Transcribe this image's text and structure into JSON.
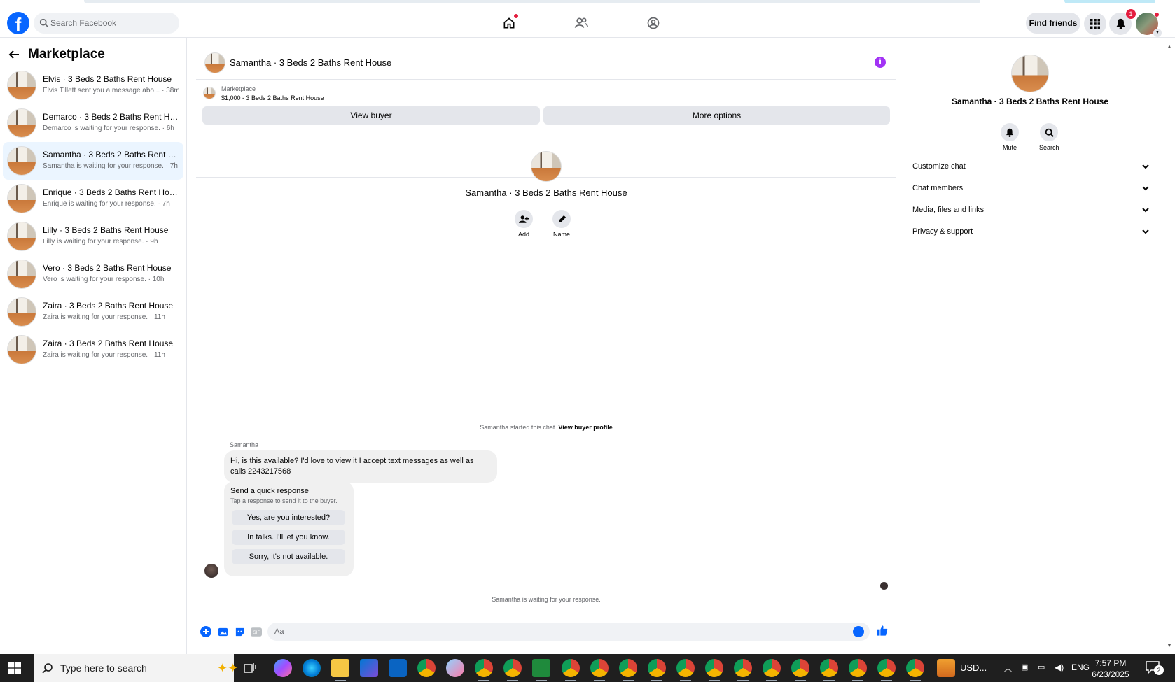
{
  "header": {
    "search_placeholder": "Search Facebook",
    "find_friends": "Find friends",
    "notification_count": "1"
  },
  "sidebar": {
    "title": "Marketplace",
    "conversations": [
      {
        "name": "Elvis · 3 Beds 2 Baths Rent House",
        "preview": "Elvis Tillett sent you a message abo... · 38m",
        "active": false
      },
      {
        "name": "Demarco · 3 Beds 2 Baths Rent Ho...",
        "preview": "Demarco is waiting for your response. · 6h",
        "active": false
      },
      {
        "name": "Samantha · 3 Beds 2 Baths Rent H...",
        "preview": "Samantha is waiting for your response. · 7h",
        "active": true
      },
      {
        "name": "Enrique · 3 Beds 2 Baths Rent House",
        "preview": "Enrique is waiting for your response. · 7h",
        "active": false
      },
      {
        "name": "Lilly · 3 Beds 2 Baths Rent House",
        "preview": "Lilly is waiting for your response. · 9h",
        "active": false
      },
      {
        "name": "Vero · 3 Beds 2 Baths Rent House",
        "preview": "Vero is waiting for your response. · 10h",
        "active": false
      },
      {
        "name": "Zaira · 3 Beds 2 Baths Rent House",
        "preview": "Zaira is waiting for your response. · 11h",
        "active": false
      },
      {
        "name": "Zaira · 3 Beds 2 Baths Rent House",
        "preview": "Zaira is waiting for your response. · 11h",
        "active": false
      }
    ]
  },
  "chat": {
    "title": "Samantha · 3 Beds 2 Baths Rent House",
    "listing_source": "Marketplace",
    "listing_price": "$1,000 - 3 Beds 2 Baths Rent House",
    "view_buyer": "View buyer",
    "more_options": "More options",
    "profile_name": "Samantha · 3 Beds 2 Baths Rent House",
    "add_label": "Add",
    "name_label": "Name",
    "started_text": "Samantha started this chat.",
    "view_buyer_profile": "View buyer profile",
    "sender": "Samantha",
    "message": "Hi, is this available? I'd love to view it I accept text messages as well as calls 2243217568",
    "quick_title": "Send a quick response",
    "quick_subtitle": "Tap a response to send it to the buyer.",
    "quick_responses": [
      "Yes, are you interested?",
      "In talks. I'll let you know.",
      "Sorry, it's not available."
    ],
    "waiting_text": "Samantha is waiting for your response.",
    "composer_placeholder": "Aa"
  },
  "right_panel": {
    "name": "Samantha · 3 Beds 2 Baths Rent House",
    "mute_label": "Mute",
    "search_label": "Search",
    "sections": [
      "Customize chat",
      "Chat members",
      "Media, files and links",
      "Privacy & support"
    ]
  },
  "taskbar": {
    "search_placeholder": "Type here to search",
    "tray_text": "USD...",
    "language": "ENG",
    "time": "7:57 PM",
    "date": "6/23/2025",
    "notification_count": "2"
  },
  "colors": {
    "brand_blue": "#0866ff",
    "active_row": "#ebf5ff",
    "info_purple": "#a233f5"
  }
}
